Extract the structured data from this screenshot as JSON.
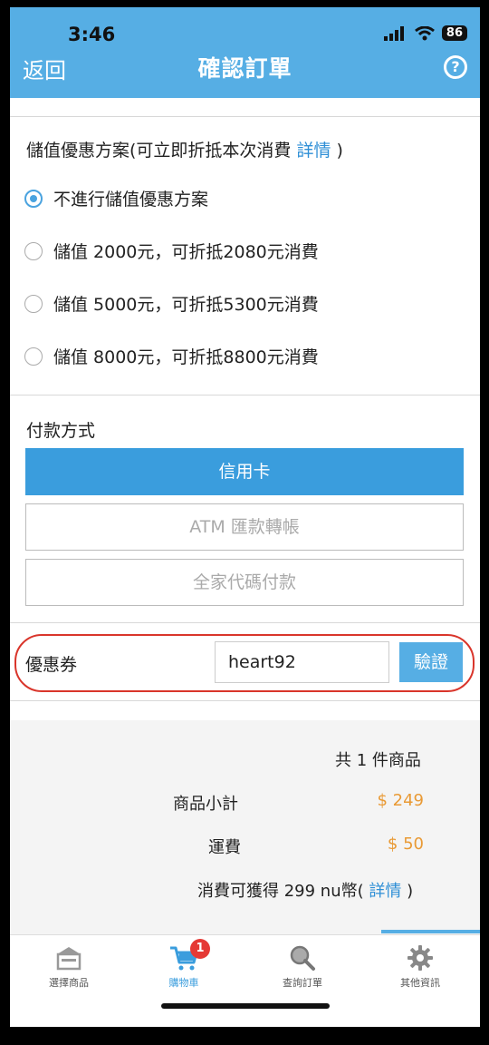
{
  "status": {
    "time": "3:46",
    "battery": "86"
  },
  "nav": {
    "back_label": "返回",
    "title": "確認訂單",
    "help_icon": "?"
  },
  "stored_value": {
    "heading": "儲值優惠方案(可立即折抵本次消費 ",
    "heading_link": "詳情",
    "heading_close": " )",
    "options": [
      {
        "label": "不進行儲值優惠方案",
        "selected": true
      },
      {
        "label": "儲值 2000元，可折抵2080元消費",
        "selected": false
      },
      {
        "label": "儲值 5000元，可折抵5300元消費",
        "selected": false
      },
      {
        "label": "儲值 8000元，可折抵8800元消費",
        "selected": false
      }
    ]
  },
  "payment": {
    "heading": "付款方式",
    "methods": [
      {
        "label": "信用卡",
        "active": true
      },
      {
        "label": "ATM 匯款轉帳",
        "active": false
      },
      {
        "label": "全家代碼付款",
        "active": false
      }
    ]
  },
  "coupon": {
    "label": "優惠券",
    "value": "heart92",
    "verify_label": "驗證"
  },
  "summary": {
    "item_count": "共 1 件商品",
    "subtotal_label": "商品小計",
    "subtotal_value": "$ 249",
    "shipping_label": "運費",
    "shipping_value": "$ 50",
    "points_text": "消費可獲得 299 nu幣( ",
    "points_link": "詳情",
    "points_close": " )"
  },
  "tabs": [
    {
      "label": "選擇商品",
      "icon": "store-icon"
    },
    {
      "label": "購物車",
      "icon": "cart-icon",
      "badge": "1"
    },
    {
      "label": "查詢訂單",
      "icon": "search-icon"
    },
    {
      "label": "其他資訊",
      "icon": "gear-icon"
    }
  ],
  "colors": {
    "primary": "#56aee4",
    "price": "#e99a35",
    "link": "#2f8fd6",
    "highlight": "#d9352b",
    "badge": "#e53935"
  }
}
